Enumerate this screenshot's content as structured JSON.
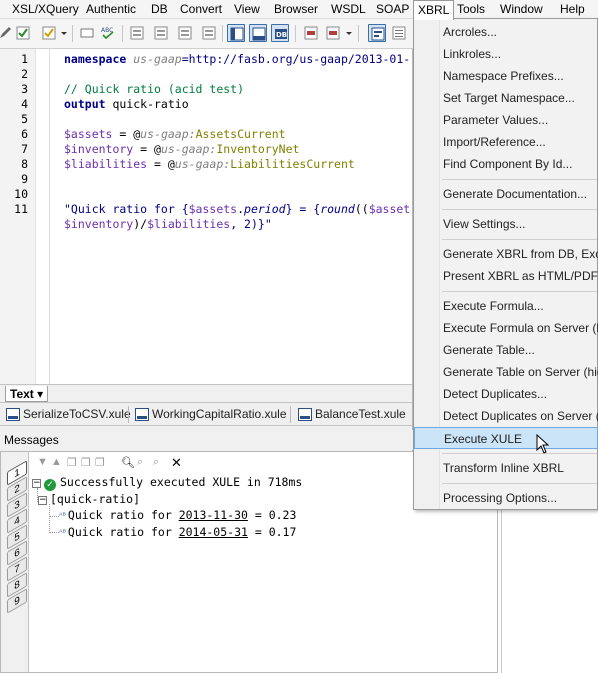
{
  "menubar": {
    "items": [
      "XSL/XQuery",
      "Authentic",
      "DB",
      "Convert",
      "View",
      "Browser",
      "WSDL",
      "SOAP",
      "XBRL",
      "Tools",
      "Window",
      "Help"
    ],
    "open_item": "XBRL"
  },
  "editor": {
    "line_numbers": [
      "1",
      "2",
      "3",
      "4",
      "5",
      "6",
      "7",
      "8",
      "9",
      "10",
      "11"
    ],
    "line1": {
      "kw": "namespace",
      "prefix": "us-gaap",
      "rest": "=http://fasb.org/us-gaap/2013-01-"
    },
    "line3": {
      "comment": "// Quick ratio (acid test)"
    },
    "line4": {
      "kw": "output",
      "rest": " quick-ratio"
    },
    "line6": {
      "var": "$assets",
      "eq": " = @",
      "prefix": "us-gaap:",
      "name": "AssetsCurrent"
    },
    "line7": {
      "var": "$inventory",
      "eq": " = @",
      "prefix": "us-gaap:",
      "name": "InventoryNet"
    },
    "line8": {
      "var": "$liabilities",
      "eq": " = @",
      "prefix": "us-gaap:",
      "name": "LiabilitiesCurrent"
    },
    "line11": {
      "s1": "\"Quick ratio for {",
      "v1": "$assets",
      "dot": ".",
      "prop": "period",
      "s2": "} = {",
      "fn": "round",
      "s3": "((",
      "v2": "$asset"
    },
    "line11b": {
      "v1": "$inventory",
      "s1": ")/",
      "v2": "$liabilities",
      "s2": ", 2)}\""
    },
    "text_view": "Text"
  },
  "file_tabs": [
    "SerializeToCSV.xule",
    "WorkingCapitalRatio.xule",
    "BalanceTest.xule"
  ],
  "messages": {
    "title": "Messages",
    "tabs": [
      "1",
      "2",
      "3",
      "4",
      "5",
      "6",
      "7",
      "8",
      "9"
    ],
    "success": "Successfully executed XULE in 718ms",
    "group": "[quick-ratio]",
    "results": [
      {
        "prefix": "Quick ratio for ",
        "date": "2013-11-30",
        "value": " = 0.23"
      },
      {
        "prefix": "Quick ratio for ",
        "date": "2014-05-31",
        "value": " = 0.17"
      }
    ]
  },
  "xbrl_menu": {
    "items": [
      "Arcroles...",
      "Linkroles...",
      "Namespace Prefixes...",
      "Set Target Namespace...",
      "Parameter Values...",
      "Import/Reference...",
      "Find Component By Id...",
      "Generate Documentation...",
      "View Settings...",
      "Generate XBRL from DB, Excel,",
      "Present XBRL as HTML/PDF/Wo",
      "Execute Formula...",
      "Execute Formula on Server (hig",
      "Generate Table...",
      "Generate Table on Server (high",
      "Detect Duplicates...",
      "Detect Duplicates on Server (h",
      "Execute XULE",
      "Transform Inline XBRL",
      "Processing Options..."
    ],
    "highlighted": "Execute XULE"
  },
  "colors": {
    "accent": "#cce4f7",
    "keyword": "#00008b",
    "comment": "#007a3d",
    "variable": "#6b2fb0",
    "success": "#1f9b3c"
  }
}
